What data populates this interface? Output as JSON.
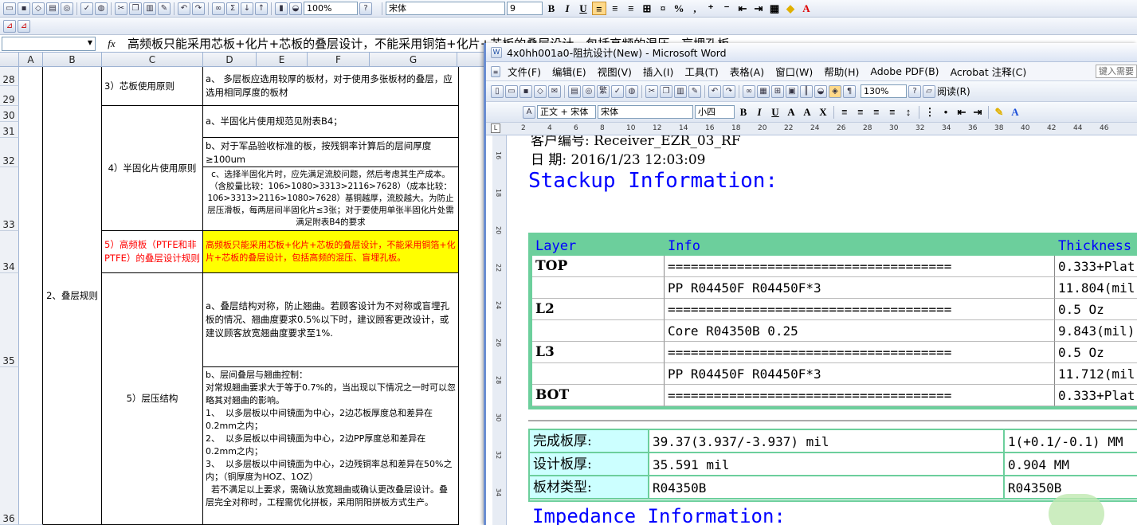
{
  "excel": {
    "toolbar": {
      "zoom": "100%",
      "font_name": "宋体",
      "font_size": "9",
      "icons": [
        "open-icon",
        "save-icon",
        "permission-icon",
        "print-icon",
        "print-preview-icon",
        "spelling-icon",
        "research-icon",
        "cut-icon",
        "copy-icon",
        "paste-icon",
        "format-painter-icon",
        "undo-icon",
        "redo-icon",
        "hyperlink-icon",
        "autosum-icon",
        "sort-asc-icon",
        "sort-desc-icon",
        "chart-wizard-icon",
        "drawing-icon",
        "help-icon"
      ]
    },
    "formula_bar": {
      "name_box": "",
      "fx_label": "fx",
      "content": "高频板只能采用芯板+化片+芯板的叠层设计，不能采用铜箔+化片+芯板的叠层设计，包括高频的混压、盲埋孔板。"
    },
    "columns": [
      "A",
      "B",
      "C",
      "D",
      "E",
      "F",
      "G"
    ],
    "rows": [
      "28",
      "29",
      "30",
      "31",
      "32",
      "33",
      "34",
      "35",
      "36"
    ],
    "cells": {
      "b_merged": "2、叠层规则",
      "c1": "3）芯板使用原则",
      "d1": "a、  多层板应选用较厚的板材，对于使用多张板材的叠层，应选用相同厚度的板材",
      "c2": "4）半固化片使用原则",
      "d2a": "a、半固化片使用规范见附表B4；",
      "d2b": "b、对于军品验收标准的板，按残铜率计算后的层间厚度≥100um",
      "d2c": "c、选择半固化片时，应先满足流胶问题，然后考虑其生产成本。（含胶量比较：106>1080>3313>2116>7628）（成本比较：106>3313>2116>1080>7628）基铜越厚，流胶越大。为防止层压滑板，每两层间半固化片≤3张；对于要使用单张半固化片处需满足附表B4的要求",
      "c3": "5）高频板（PTFE和非PTFE）的叠层设计规则",
      "d3": "高频板只能采用芯板+化片+芯板的叠层设计，不能采用铜箔+化片+芯板的叠层设计，包括高频的混压、盲埋孔板。",
      "c4": "5）层压结构",
      "d4a": "a、叠层结构对称，防止翘曲。若顾客设计为不对称或盲埋孔板的情况、翘曲度要求0.5%以下时，建议顾客更改设计，或建议顾客放宽翘曲度要求至1%.",
      "d4b": "b、层间叠层与翘曲控制：\n对常规翘曲要求大于等于0.7%的，当出现以下情况之一时可以忽略其对翘曲的影响。\n1、  以多层板以中间镜面为中心，2边芯板厚度总和差异在0.2mm之内；\n2、  以多层板以中间镜面为中心，2边PP厚度总和差异在0.2mm之内；\n3、  以多层板以中间镜面为中心，2边残铜率总和差异在50%之内；（铜厚度为HOZ、1OZ）\n  若不满足以上要求，需确认放宽翘曲或确认更改叠层设计。叠层完全对称时，工程需优化拼板，采用阴阳拼板方式生产。"
    }
  },
  "word": {
    "title": "4x0hh001a0-阻抗设计(New) - Microsoft Word",
    "menu": [
      "文件(F)",
      "编辑(E)",
      "视图(V)",
      "插入(I)",
      "工具(T)",
      "表格(A)",
      "窗口(W)",
      "帮助(H)",
      "Adobe PDF(B)",
      "Acrobat 注释(C)"
    ],
    "help_box": "键入需要",
    "toolbar": {
      "zoom": "130%",
      "reading": "阅读(R)",
      "style": "正文 + 宋体",
      "font": "宋体",
      "size": "小四"
    },
    "ruler_marks": [
      "2",
      "4",
      "6",
      "8",
      "10",
      "12",
      "14",
      "16",
      "18",
      "20",
      "22",
      "24",
      "26",
      "28",
      "30",
      "32",
      "34",
      "36",
      "38",
      "40",
      "42",
      "44",
      "46"
    ],
    "vruler_marks": [
      "16",
      "18",
      "20",
      "22",
      "24",
      "26",
      "28",
      "30",
      "32",
      "34"
    ],
    "doc": {
      "line_customer": "客户编号: Receiver_EZR_03_RF",
      "line_date_label": "日    期:",
      "line_date_value": "2016/1/23 12:03:09",
      "stackup_heading": "Stackup Information:",
      "impedance_heading": "Impedance Information:",
      "stackup_headers": [
        "Layer",
        "Info",
        "Thickness"
      ],
      "stackup_rows": [
        {
          "layer": "TOP",
          "info": "=====================================",
          "thickness": "0.333+Plat"
        },
        {
          "layer": "",
          "info": "PP     R04450F    R04450F*3",
          "thickness": "11.804(mil"
        },
        {
          "layer": "L2",
          "info": "=====================================",
          "thickness": "0.5 Oz"
        },
        {
          "layer": "",
          "info": "Core     R04350B    0.25",
          "thickness": "9.843(mil)"
        },
        {
          "layer": "L3",
          "info": "=====================================",
          "thickness": "0.5 Oz"
        },
        {
          "layer": "",
          "info": "PP     R04450F    R04450F*3",
          "thickness": "11.712(mil"
        },
        {
          "layer": "BOT",
          "info": "=====================================",
          "thickness": "0.333+Plat"
        }
      ],
      "board_rows": [
        {
          "label": "完成板厚:",
          "value": "39.37(3.937/-3.937) mil",
          "extra": "1(+0.1/-0.1) MM"
        },
        {
          "label": "设计板厚:",
          "value": "35.591 mil",
          "extra": "0.904 MM"
        },
        {
          "label": "板材类型:",
          "value": "R04350B",
          "extra": "R04350B"
        }
      ]
    }
  },
  "colors": {
    "highlight": "#ffff00",
    "highlight_text": "#ff0000",
    "stack_green": "#6ccf9c",
    "board_cyan": "#ccffff",
    "heading_blue": "#0000ff"
  }
}
